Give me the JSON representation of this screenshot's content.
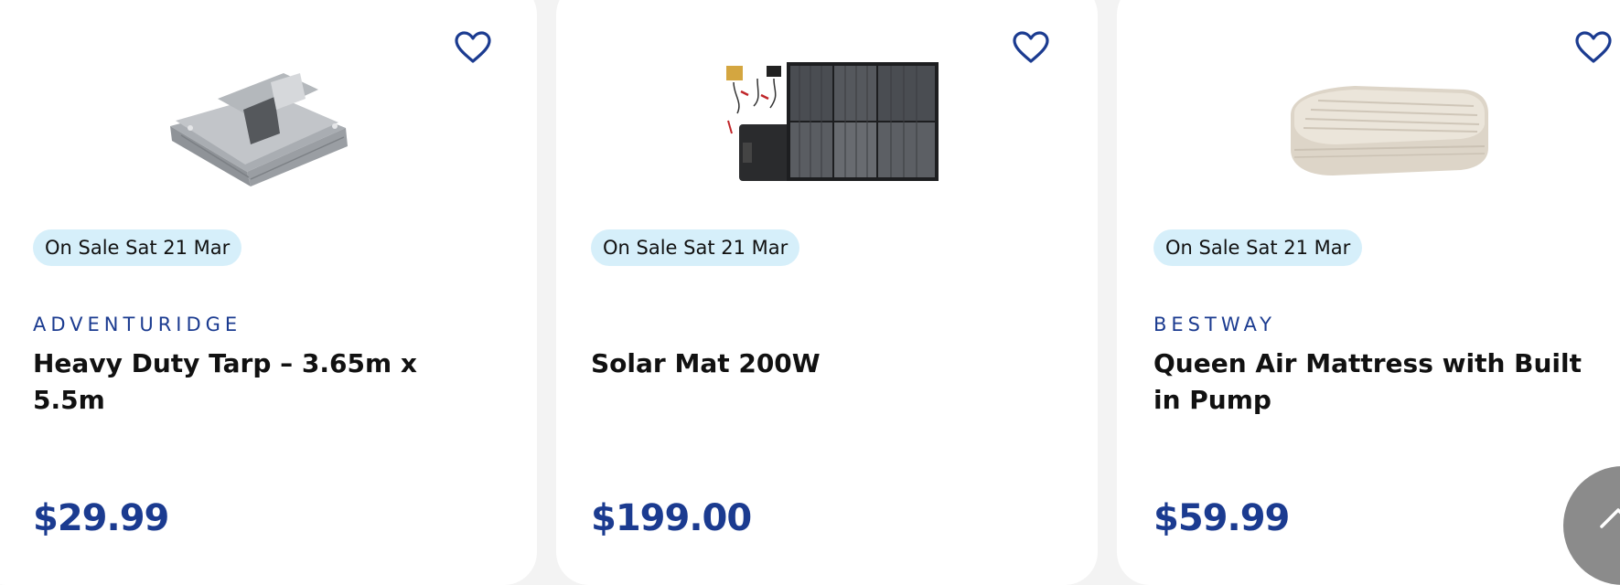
{
  "products": [
    {
      "badge": "On Sale Sat 21 Mar",
      "brand": "ADVENTURIDGE",
      "title": "Heavy Duty Tarp – 3.65m x 5.5m",
      "price": "$29.99",
      "image_icon": "folded-tarp-image"
    },
    {
      "badge": "On Sale Sat 21 Mar",
      "brand": "",
      "title": "Solar Mat 200W",
      "price": "$199.00",
      "image_icon": "solar-mat-image"
    },
    {
      "badge": "On Sale Sat 21 Mar",
      "brand": "BESTWAY",
      "title": "Queen Air Mattress with Built in Pump",
      "price": "$59.99",
      "image_icon": "air-mattress-image"
    }
  ],
  "icons": {
    "favourite": "heart-outline-icon",
    "scroll_top": "chevron-up-icon"
  },
  "colors": {
    "background": "#f3f3f3",
    "card": "#ffffff",
    "brand_blue": "#1b3b90",
    "badge_bg": "#d6effa",
    "text": "#111111",
    "scroll_button": "#8b8b8b"
  }
}
